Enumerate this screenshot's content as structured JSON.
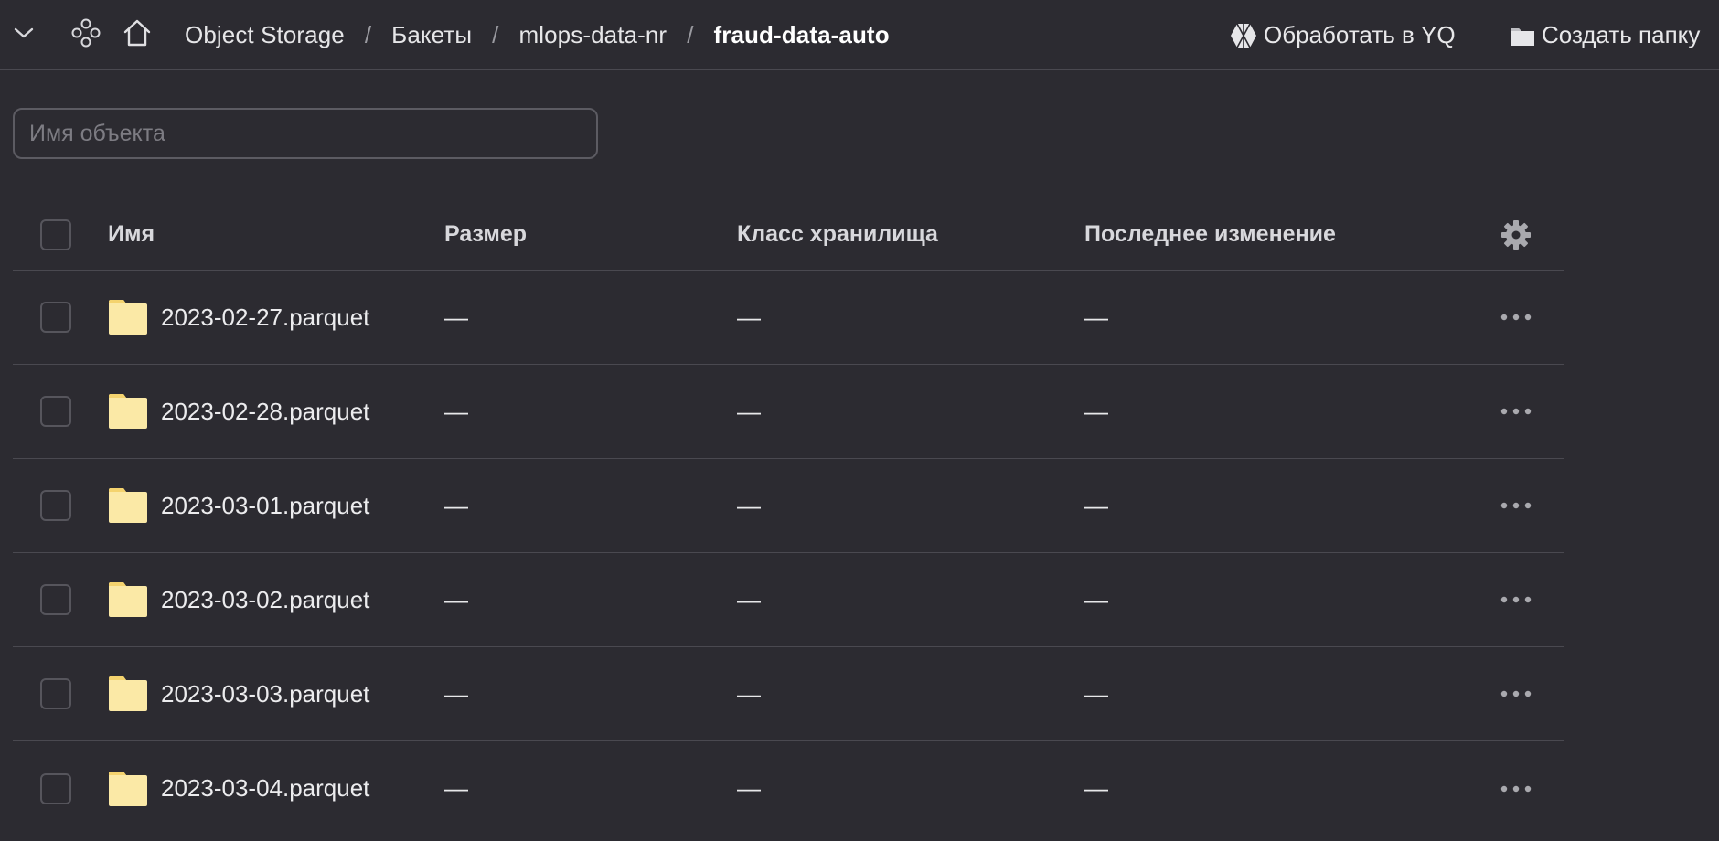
{
  "breadcrumb": {
    "items": [
      "Object Storage",
      "Бакеты",
      "mlops-data-nr"
    ],
    "current": "fraud-data-auto",
    "separator": "/"
  },
  "actions": {
    "process_yq": "Обработать в YQ",
    "create_folder": "Создать папку"
  },
  "search": {
    "placeholder": "Имя объекта",
    "value": ""
  },
  "table": {
    "columns": {
      "name": "Имя",
      "size": "Размер",
      "storage_class": "Класс хранилища",
      "modified": "Последнее изменение"
    },
    "rows": [
      {
        "name": "2023-02-27.parquet",
        "size": "—",
        "storage_class": "—",
        "modified": "—"
      },
      {
        "name": "2023-02-28.parquet",
        "size": "—",
        "storage_class": "—",
        "modified": "—"
      },
      {
        "name": "2023-03-01.parquet",
        "size": "—",
        "storage_class": "—",
        "modified": "—"
      },
      {
        "name": "2023-03-02.parquet",
        "size": "—",
        "storage_class": "—",
        "modified": "—"
      },
      {
        "name": "2023-03-03.parquet",
        "size": "—",
        "storage_class": "—",
        "modified": "—"
      },
      {
        "name": "2023-03-04.parquet",
        "size": "—",
        "storage_class": "—",
        "modified": "—"
      }
    ]
  },
  "icons": {
    "collapse": "chevron-down-icon",
    "services": "services-icon",
    "home": "home-icon",
    "yq": "yq-icon",
    "folder": "folder-icon",
    "settings": "gear-icon",
    "row_menu": "more-horizontal-icon"
  },
  "colors": {
    "background": "#2c2b31",
    "border": "#4a4950",
    "folder": "#fbe9a6",
    "text": "#e8e8ea"
  }
}
